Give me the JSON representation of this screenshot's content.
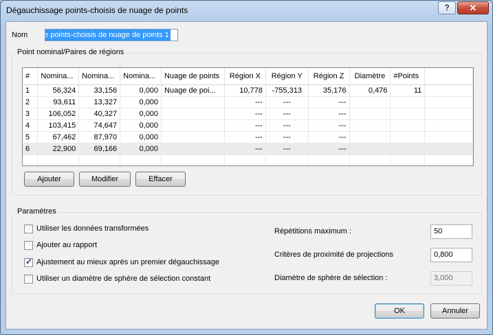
{
  "window": {
    "title": "Dégauchissage points-choisis de nuage de points",
    "help_label": "?",
    "close_label": "✕"
  },
  "nom": {
    "label": "Nom",
    "value": "ge points-choisis de nuage de points 1"
  },
  "group_points": {
    "title": "Point nominal/Paires de régions"
  },
  "table": {
    "columns": [
      "#",
      "Nomina...",
      "Nomina...",
      "Nomina...",
      "Nuage de points",
      "Région X",
      "Région Y",
      "Région Z",
      "Diamètre",
      "#Points"
    ],
    "rows": [
      [
        "1",
        "56,324",
        "33,156",
        "0,000",
        "Nuage de poi...",
        "10,778",
        "-755,313",
        "35,176",
        "0,476",
        "11"
      ],
      [
        "2",
        "93,611",
        "13,327",
        "0,000",
        "",
        "---",
        "---",
        "---",
        "",
        ""
      ],
      [
        "3",
        "106,052",
        "40,327",
        "0,000",
        "",
        "---",
        "---",
        "---",
        "",
        ""
      ],
      [
        "4",
        "103,415",
        "74,647",
        "0,000",
        "",
        "---",
        "---",
        "---",
        "",
        ""
      ],
      [
        "5",
        "67,462",
        "87,970",
        "0,000",
        "",
        "---",
        "---",
        "---",
        "",
        ""
      ],
      [
        "6",
        "22,900",
        "69,166",
        "0,000",
        "",
        "---",
        "---",
        "---",
        "",
        ""
      ]
    ]
  },
  "buttons": {
    "ajouter": "Ajouter",
    "modifier": "Modifier",
    "effacer": "Effacer",
    "ok": "OK",
    "annuler": "Annuler"
  },
  "params": {
    "title": "Paramètres",
    "checkboxes": [
      {
        "label": "Utiliser les données transformées",
        "checked": false
      },
      {
        "label": "Ajouter au rapport",
        "checked": false
      },
      {
        "label": "Ajustement au mieux après un premier dégauchissage",
        "checked": true
      },
      {
        "label": "Utiliser un diamètre de sphère de sélection constant",
        "checked": false
      }
    ],
    "repetitions_label": "Répétitions maximum :",
    "repetitions_value": "50",
    "proximite_label": "Critères de proximité de projections",
    "proximite_value": "0,800",
    "diametre_label": "Diamètre de sphère de sélection :",
    "diametre_value": "3,000"
  }
}
